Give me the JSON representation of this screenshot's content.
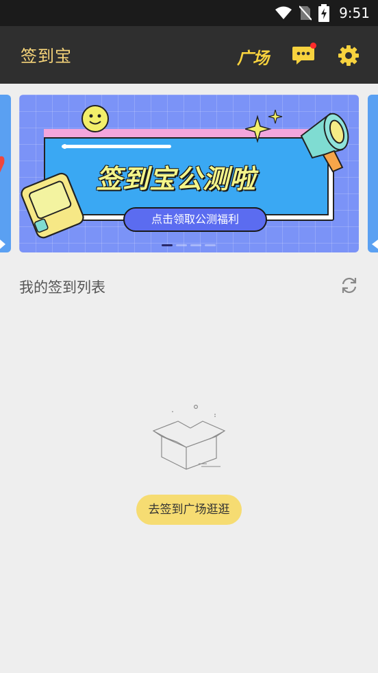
{
  "status_bar": {
    "time": "9:51",
    "icons": [
      "wifi-icon",
      "no-sim-icon",
      "battery-charging-icon"
    ]
  },
  "header": {
    "title": "签到宝",
    "square_label": "广场",
    "icons": [
      "message-icon",
      "gear-icon"
    ],
    "unread_badge_color": "#ff2b2b",
    "accent_color": "#f7d57a"
  },
  "banner": {
    "headline": "签到宝公测啦",
    "cta": "点击领取公测福利",
    "pages": 4,
    "active_page": 1
  },
  "main": {
    "section_title": "我的签到列表",
    "empty_action": "去签到广场逛逛"
  }
}
